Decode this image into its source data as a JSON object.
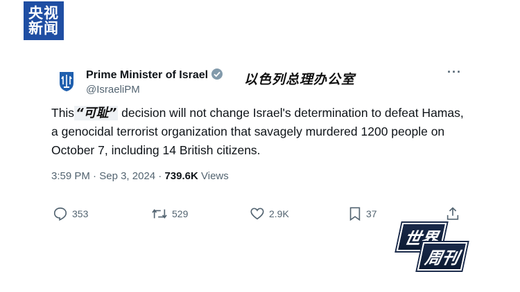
{
  "broadcaster_logo": {
    "line1": "央视",
    "line2": "新闻"
  },
  "account": {
    "name": "Prime Minister of Israel",
    "handle": "@IsraeliPM",
    "overlay_caption": "以色列总理办公室"
  },
  "tweet": {
    "text_before": "This",
    "inline_overlay": "“可耻”",
    "text_after": " decision will not change Israel's determination to defeat Hamas, a genocidal terrorist organization that savagely murdered 1200 people on October 7, including 14 British citizens."
  },
  "meta": {
    "time": "3:59 PM",
    "date": "Sep 3, 2024",
    "separator": "·",
    "views_count": "739.6K",
    "views_label": "Views"
  },
  "actions": {
    "replies": "353",
    "reposts": "529",
    "likes": "2.9K",
    "bookmarks": "37"
  },
  "more_label": "···",
  "watermark": {
    "line1": "世界",
    "line2": "周刊"
  },
  "colors": {
    "logo_bg": "#1f4ea3",
    "muted": "#536471",
    "text": "#0f1419",
    "verified": "#829aab"
  }
}
